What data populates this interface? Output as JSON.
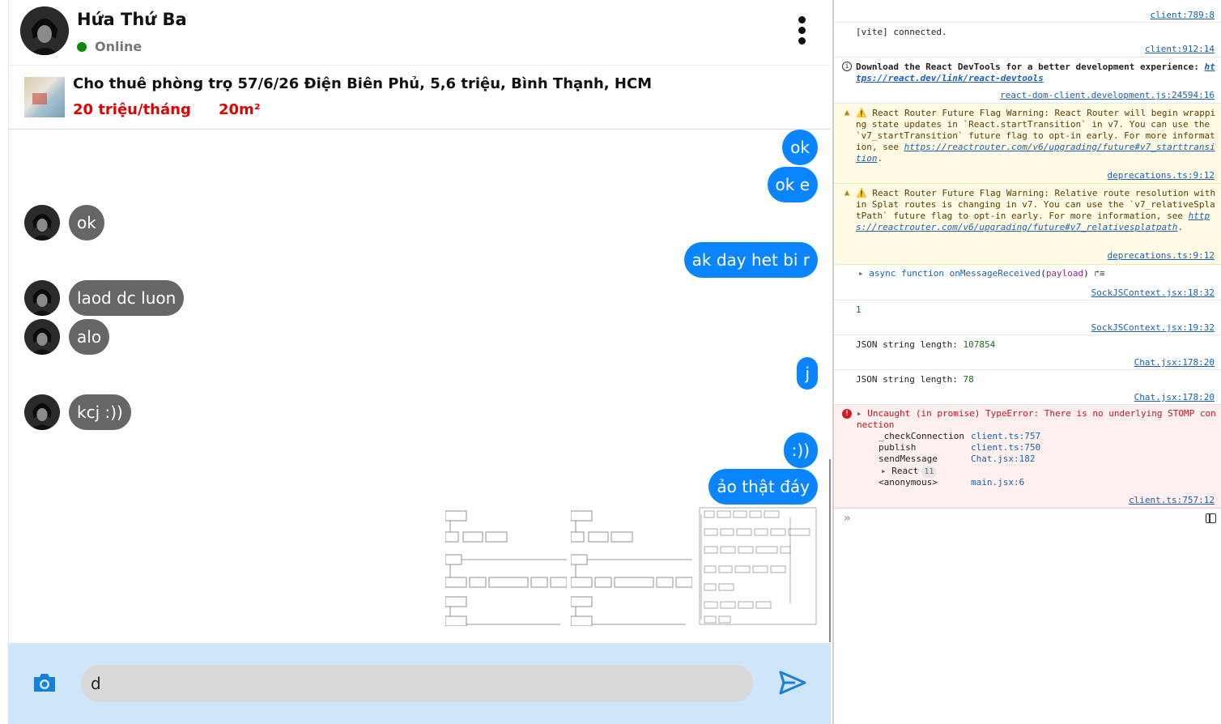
{
  "chat": {
    "contact_name": "Hứa Thứ Ba",
    "status": "Online",
    "listing": {
      "title": "Cho thuê phòng trọ 57/6/26 Điện Biên Phủ, 5,6 triệu, Bình Thạnh, HCM",
      "price": "20 triệu/tháng",
      "area": "20m²"
    },
    "messages": [
      {
        "from": "me",
        "text": "ok"
      },
      {
        "from": "me",
        "text": "ok e"
      },
      {
        "from": "them",
        "text": "ok"
      },
      {
        "from": "me",
        "text": "ak day het bi r"
      },
      {
        "from": "them",
        "text": "laod dc luon"
      },
      {
        "from": "them",
        "text": "alo"
      },
      {
        "from": "me",
        "text": "j"
      },
      {
        "from": "them",
        "text": "kcj :))"
      },
      {
        "from": "me",
        "text": ":))"
      },
      {
        "from": "me",
        "text": "ảo thật đáy"
      }
    ],
    "input_value": "d",
    "colors": {
      "my_bubble": "#0a84ff",
      "their_bubble": "#666666",
      "composer_bg": "#cfe5f9",
      "price_red": "#e00000"
    }
  },
  "console": {
    "entries": [
      {
        "type": "log",
        "text": "",
        "source": "client:789:8"
      },
      {
        "type": "log",
        "text": "[vite] connected.",
        "source": "client:912:14"
      },
      {
        "type": "info",
        "text_bold": "Download the React DevTools for a better development experience: ",
        "link": "https://react.dev/link/react-devtools",
        "source": "react-dom-client.development.js:24594:16"
      },
      {
        "type": "warn",
        "text": "⚠️ React Router Future Flag Warning: React Router will begin wrapping state updates in `React.startTransition` in v7. You can use the `v7_startTransition` future flag to opt-in early. For more information, see ",
        "link": "https://reactrouter.com/v6/upgrading/future#v7_starttransition",
        "source": "deprecations.ts:9:12"
      },
      {
        "type": "warn",
        "text": "⚠️ React Router Future Flag Warning: Relative route resolution within Splat routes is changing in v7. You can use the `v7_relativeSplatPath` future flag to opt-in early. For more information, see ",
        "link": "https://reactrouter.com/v6/upgrading/future#v7_relativesplatpath",
        "source": "deprecations.ts:9:12"
      },
      {
        "type": "fn",
        "keyword": "async function",
        "name": "onMessageReceived",
        "param": "payload",
        "source": "SockJSContext.jsx:18:32"
      },
      {
        "type": "log",
        "number": "1",
        "source": "SockJSContext.jsx:19:32"
      },
      {
        "type": "log",
        "label": "JSON string length: ",
        "number": "107854",
        "source": "Chat.jsx:178:20"
      },
      {
        "type": "log",
        "label": "JSON string length: ",
        "number": "78",
        "source": "Chat.jsx:178:20"
      },
      {
        "type": "error",
        "text": "Uncaught (in promise) TypeError: There is no underlying STOMP connection",
        "source": "client.ts:757:12",
        "stack": [
          {
            "fn": "_checkConnection",
            "loc": "client.ts:757"
          },
          {
            "fn": "publish",
            "loc": "client.ts:750"
          },
          {
            "fn": "sendMessage",
            "loc": "Chat.jsx:182"
          },
          {
            "fn": "React",
            "badge": "11"
          },
          {
            "fn": "<anonymous>",
            "loc": "main.jsx:6"
          }
        ]
      }
    ]
  }
}
